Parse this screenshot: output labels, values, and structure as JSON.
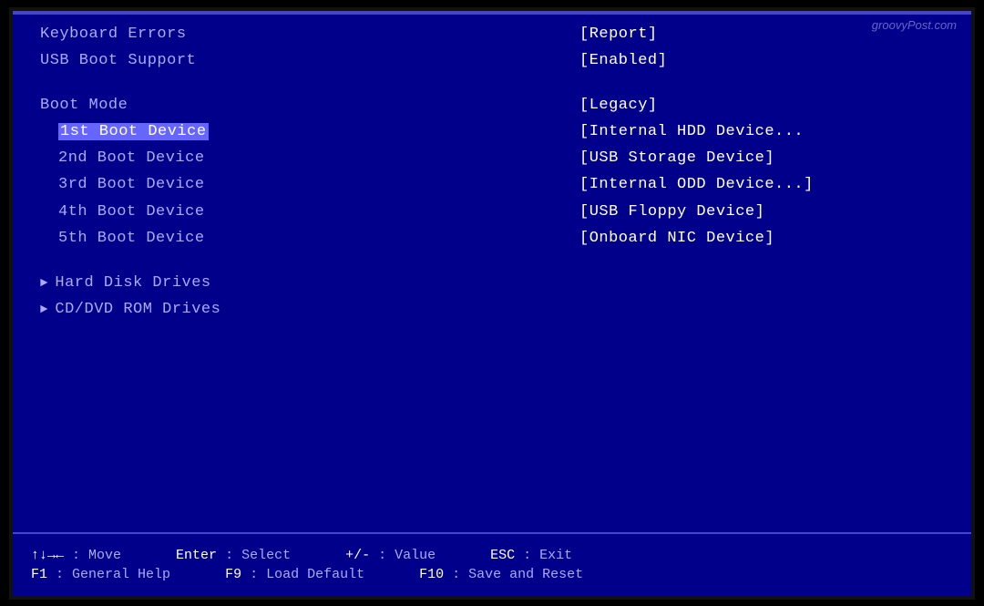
{
  "watermark": "groovyPost.com",
  "top_items": [
    {
      "label": "Keyboard Errors",
      "value": "[Report]"
    },
    {
      "label": "USB Boot Support",
      "value": "[Enabled]"
    }
  ],
  "boot_section": {
    "boot_mode_label": "Boot Mode",
    "boot_mode_value": "[Legacy]",
    "boot_devices": [
      {
        "label": "1st Boot Device",
        "value": "[Internal HDD Device...",
        "selected": true
      },
      {
        "label": "2nd Boot Device",
        "value": "[USB Storage Device]",
        "selected": false
      },
      {
        "label": "3rd Boot Device",
        "value": "[Internal ODD Device...]",
        "selected": false
      },
      {
        "label": "4th Boot Device",
        "value": "[USB Floppy Device]",
        "selected": false
      },
      {
        "label": "5th Boot Device",
        "value": "[Onboard NIC Device]",
        "selected": false
      }
    ]
  },
  "drive_sections": [
    {
      "label": "Hard Disk Drives"
    },
    {
      "label": "CD/DVD ROM Drives"
    }
  ],
  "bottom_bar": {
    "row1": [
      {
        "key": "↑↓→←",
        "desc": ": Move"
      },
      {
        "key": "Enter",
        "desc": ": Select"
      },
      {
        "key": "+/-",
        "desc": ": Value"
      },
      {
        "key": "ESC",
        "desc": ": Exit"
      }
    ],
    "row2": [
      {
        "key": "F1",
        "desc": ": General Help"
      },
      {
        "key": "F9",
        "desc": ": Load Default"
      },
      {
        "key": "F10",
        "desc": ": Save and Reset"
      }
    ]
  }
}
